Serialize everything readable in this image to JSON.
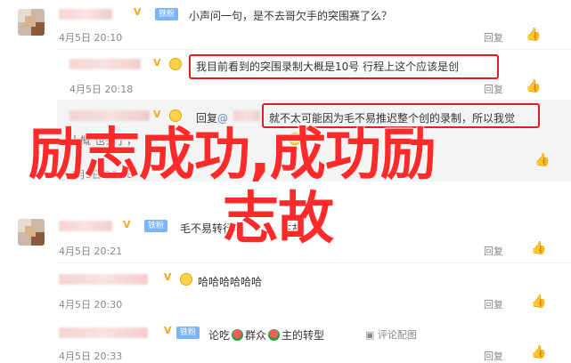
{
  "comments": [
    {
      "text": "小声问一句，是不去哥欠手的突围赛了么？",
      "badge": "铁粉",
      "time": "4月5日 20:10",
      "reply": "回复",
      "likes": ""
    },
    {
      "text": "我目前看到的突围录制大概是10号 行程上这个应该是创",
      "time": "4月5日 20:18",
      "reply": "回复",
      "likes": ""
    },
    {
      "reply_prefix": "回复",
      "reply_mention": "@",
      "text": "就不太可能因为毛不易推迟整个创的录制，所以我觉",
      "second_line": "大概 也会了，",
      "time": "4月5日 20:28",
      "reply": "回复",
      "likes": ""
    },
    {
      "text": "毛不易转行吧",
      "text_tail": "主故",
      "badge": "铁粉",
      "time": "4月5日 20:21",
      "reply": "回复",
      "likes": ""
    },
    {
      "text": "哈哈哈哈哈哈",
      "time": "4月5日 20:30",
      "reply": "回复",
      "likes": ""
    },
    {
      "badge": "铁粉",
      "text_a": "论吃",
      "text_b": "群众",
      "text_c": "主的转型",
      "extra": "评论配图",
      "time": "4月5日 20:33",
      "reply": "回复",
      "likes": ""
    }
  ],
  "overlay": {
    "line1": "励志成功,成功励",
    "line2": "志故"
  },
  "colors": {
    "highlight_box": "#e02020",
    "overlay_text": "#ff2b2b",
    "badge_blue": "#7cb5ff"
  },
  "icons": {
    "like": "thumbs-up-icon",
    "verified": "v-badge-icon"
  }
}
